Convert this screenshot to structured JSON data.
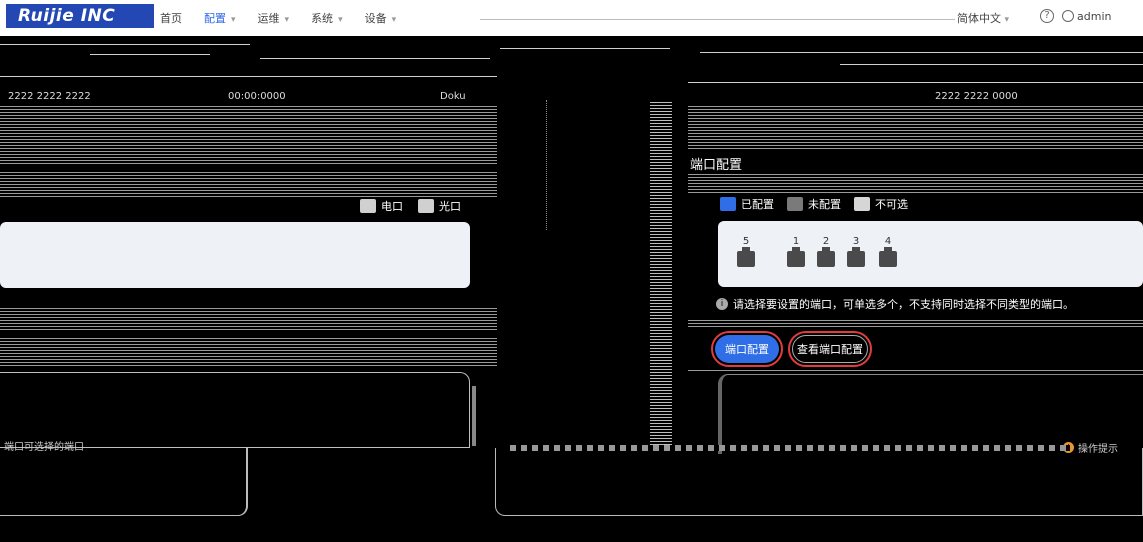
{
  "brand": {
    "logo_text": "Ruijie INC"
  },
  "nav": {
    "items": [
      {
        "label": "首页",
        "dropdown": false,
        "active": false
      },
      {
        "label": "配置",
        "dropdown": true,
        "active": true
      },
      {
        "label": "运维",
        "dropdown": true,
        "active": false
      },
      {
        "label": "系统",
        "dropdown": true,
        "active": false
      },
      {
        "label": "设备",
        "dropdown": true,
        "active": false
      }
    ],
    "language": "简体中文",
    "user": "admin"
  },
  "info": {
    "left_serial": "2222 2222 2222",
    "left_mid": "00:00:0000",
    "left_right": "Doku",
    "right_serial": "2222 2222 0000"
  },
  "left_panel": {
    "legend": [
      {
        "label": "电口"
      },
      {
        "label": "光口"
      }
    ],
    "caption": "端口可选择的端口"
  },
  "right_panel": {
    "title": "端口配置",
    "legend": [
      {
        "label": "已配置",
        "color": "#2f6ee6"
      },
      {
        "label": "未配置",
        "color": "#7a7a7a"
      },
      {
        "label": "不可选",
        "color": "#d6d6d6"
      }
    ],
    "ports": [
      {
        "number": "5"
      },
      {
        "number": "1"
      },
      {
        "number": "2"
      },
      {
        "number": "3"
      },
      {
        "number": "4"
      }
    ],
    "hint": "请选择要设置的端口，可单选多个，不支持同时选择不同类型的端口。",
    "buttons": {
      "configure": "端口配置",
      "view": "查看端口配置"
    },
    "warning": "操作提示"
  }
}
